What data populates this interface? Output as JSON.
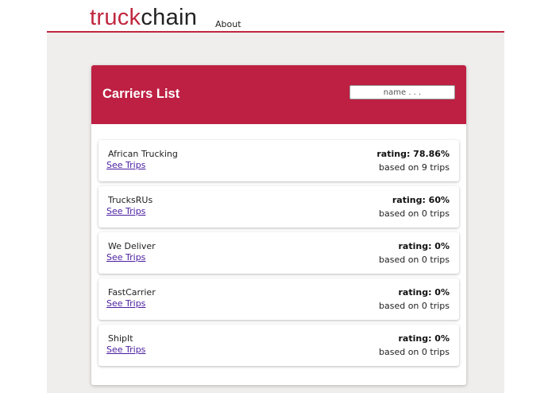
{
  "header": {
    "logo_part1": "truck",
    "logo_part2": "chain",
    "nav_about": "About"
  },
  "colors": {
    "brand": "#bd2042",
    "link": "#4a1ea0",
    "page_bg": "#efeeec"
  },
  "card": {
    "title": "Carriers List",
    "search_placeholder": "name . . ."
  },
  "carriers": [
    {
      "name": "African Trucking",
      "link": "See Trips",
      "rating": "rating: 78.86%",
      "trips": "based on 9 trips"
    },
    {
      "name": "TrucksRUs",
      "link": "See Trips",
      "rating": "rating: 60%",
      "trips": "based on 0 trips"
    },
    {
      "name": "We Deliver",
      "link": "See Trips",
      "rating": "rating: 0%",
      "trips": "based on 0 trips"
    },
    {
      "name": "FastCarrier",
      "link": "See Trips",
      "rating": "rating: 0%",
      "trips": "based on 0 trips"
    },
    {
      "name": "ShipIt",
      "link": "See Trips",
      "rating": "rating: 0%",
      "trips": "based on 0 trips"
    }
  ]
}
